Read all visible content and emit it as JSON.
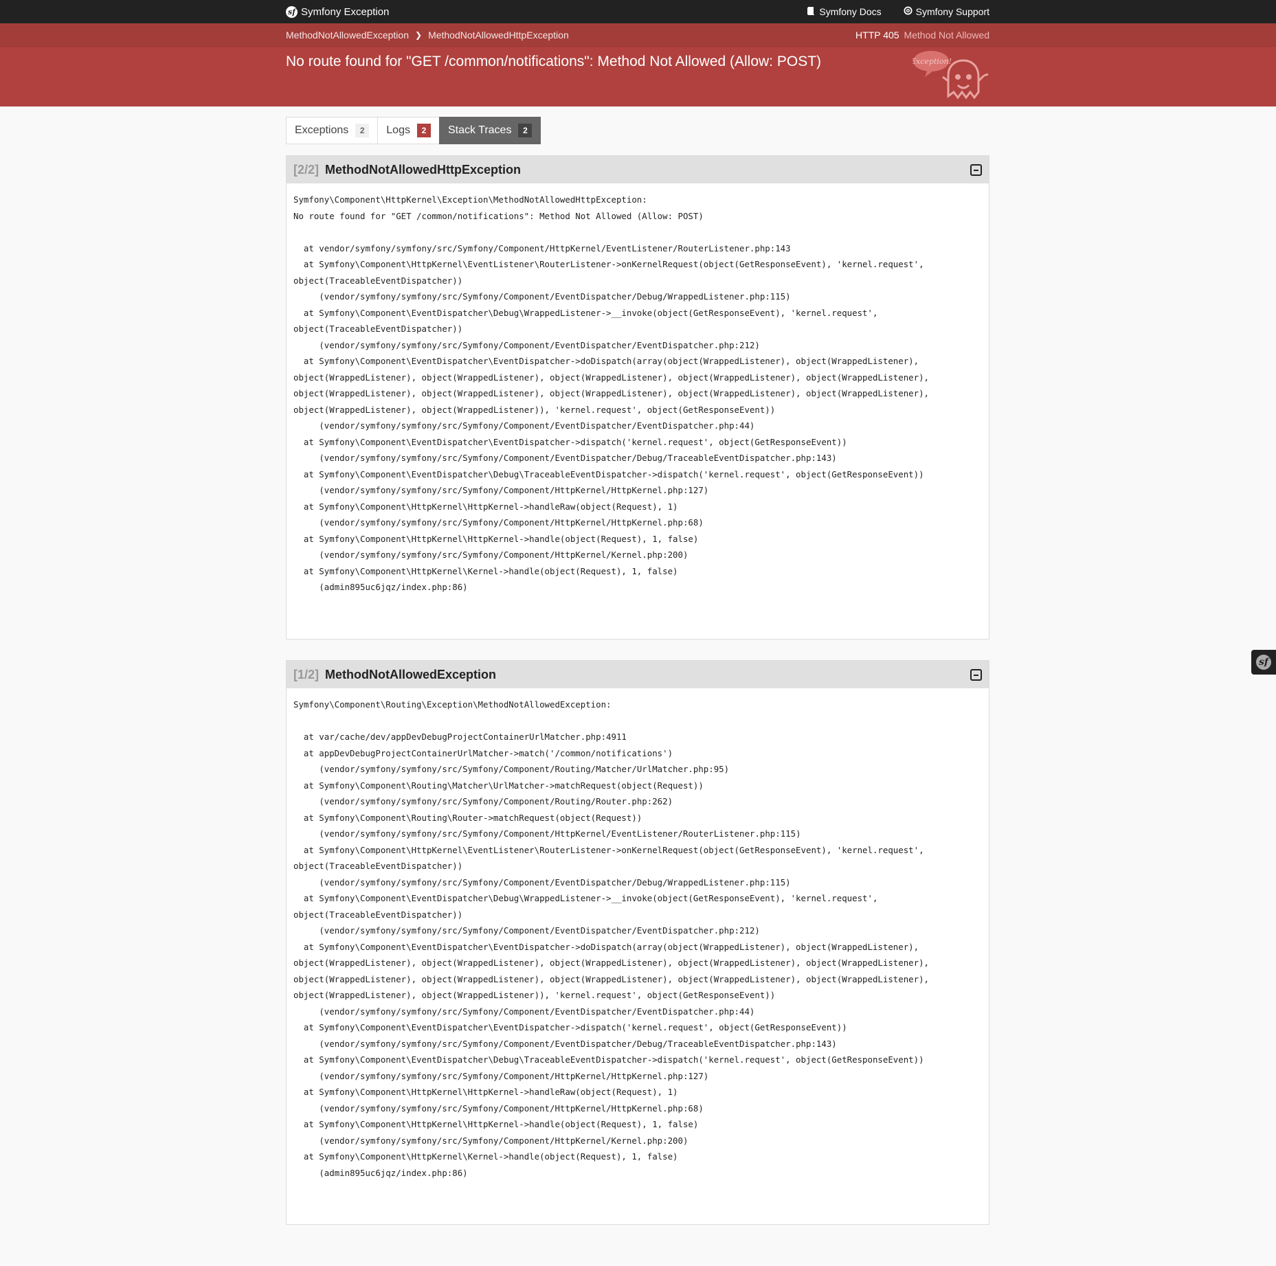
{
  "topbar": {
    "brand": "Symfony Exception",
    "docs_label": "Symfony Docs",
    "support_label": "Symfony Support",
    "logo_glyph": "sf"
  },
  "breadcrumb": {
    "items": [
      "MethodNotAllowedException",
      "MethodNotAllowedHttpException"
    ],
    "separator": "❯"
  },
  "status": {
    "code": "HTTP 405",
    "text": "Method Not Allowed"
  },
  "exception_message": "No route found for \"GET /common/notifications\": Method Not Allowed (Allow: POST)",
  "ghost_bubble_text": "Exception!",
  "tabs": [
    {
      "label": "Exceptions",
      "count": "2"
    },
    {
      "label": "Logs",
      "count": "2"
    },
    {
      "label": "Stack Traces",
      "count": "2"
    }
  ],
  "traces": [
    {
      "index": "[2/2]",
      "title": "MethodNotAllowedHttpException",
      "text": "Symfony\\Component\\HttpKernel\\Exception\\MethodNotAllowedHttpException:\nNo route found for \"GET /common/notifications\": Method Not Allowed (Allow: POST)\n\n  at vendor/symfony/symfony/src/Symfony/Component/HttpKernel/EventListener/RouterListener.php:143\n  at Symfony\\Component\\HttpKernel\\EventListener\\RouterListener->onKernelRequest(object(GetResponseEvent), 'kernel.request',\nobject(TraceableEventDispatcher))\n     (vendor/symfony/symfony/src/Symfony/Component/EventDispatcher/Debug/WrappedListener.php:115)\n  at Symfony\\Component\\EventDispatcher\\Debug\\WrappedListener->__invoke(object(GetResponseEvent), 'kernel.request',\nobject(TraceableEventDispatcher))\n     (vendor/symfony/symfony/src/Symfony/Component/EventDispatcher/EventDispatcher.php:212)\n  at Symfony\\Component\\EventDispatcher\\EventDispatcher->doDispatch(array(object(WrappedListener), object(WrappedListener),\nobject(WrappedListener), object(WrappedListener), object(WrappedListener), object(WrappedListener), object(WrappedListener),\nobject(WrappedListener), object(WrappedListener), object(WrappedListener), object(WrappedListener), object(WrappedListener),\nobject(WrappedListener), object(WrappedListener)), 'kernel.request', object(GetResponseEvent))\n     (vendor/symfony/symfony/src/Symfony/Component/EventDispatcher/EventDispatcher.php:44)\n  at Symfony\\Component\\EventDispatcher\\EventDispatcher->dispatch('kernel.request', object(GetResponseEvent))\n     (vendor/symfony/symfony/src/Symfony/Component/EventDispatcher/Debug/TraceableEventDispatcher.php:143)\n  at Symfony\\Component\\EventDispatcher\\Debug\\TraceableEventDispatcher->dispatch('kernel.request', object(GetResponseEvent))\n     (vendor/symfony/symfony/src/Symfony/Component/HttpKernel/HttpKernel.php:127)\n  at Symfony\\Component\\HttpKernel\\HttpKernel->handleRaw(object(Request), 1)\n     (vendor/symfony/symfony/src/Symfony/Component/HttpKernel/HttpKernel.php:68)\n  at Symfony\\Component\\HttpKernel\\HttpKernel->handle(object(Request), 1, false)\n     (vendor/symfony/symfony/src/Symfony/Component/HttpKernel/Kernel.php:200)\n  at Symfony\\Component\\HttpKernel\\Kernel->handle(object(Request), 1, false)\n     (admin895uc6jqz/index.php:86)"
    },
    {
      "index": "[1/2]",
      "title": "MethodNotAllowedException",
      "text": "Symfony\\Component\\Routing\\Exception\\MethodNotAllowedException:\n\n  at var/cache/dev/appDevDebugProjectContainerUrlMatcher.php:4911\n  at appDevDebugProjectContainerUrlMatcher->match('/common/notifications')\n     (vendor/symfony/symfony/src/Symfony/Component/Routing/Matcher/UrlMatcher.php:95)\n  at Symfony\\Component\\Routing\\Matcher\\UrlMatcher->matchRequest(object(Request))\n     (vendor/symfony/symfony/src/Symfony/Component/Routing/Router.php:262)\n  at Symfony\\Component\\Routing\\Router->matchRequest(object(Request))\n     (vendor/symfony/symfony/src/Symfony/Component/HttpKernel/EventListener/RouterListener.php:115)\n  at Symfony\\Component\\HttpKernel\\EventListener\\RouterListener->onKernelRequest(object(GetResponseEvent), 'kernel.request',\nobject(TraceableEventDispatcher))\n     (vendor/symfony/symfony/src/Symfony/Component/EventDispatcher/Debug/WrappedListener.php:115)\n  at Symfony\\Component\\EventDispatcher\\Debug\\WrappedListener->__invoke(object(GetResponseEvent), 'kernel.request',\nobject(TraceableEventDispatcher))\n     (vendor/symfony/symfony/src/Symfony/Component/EventDispatcher/EventDispatcher.php:212)\n  at Symfony\\Component\\EventDispatcher\\EventDispatcher->doDispatch(array(object(WrappedListener), object(WrappedListener),\nobject(WrappedListener), object(WrappedListener), object(WrappedListener), object(WrappedListener), object(WrappedListener),\nobject(WrappedListener), object(WrappedListener), object(WrappedListener), object(WrappedListener), object(WrappedListener),\nobject(WrappedListener), object(WrappedListener)), 'kernel.request', object(GetResponseEvent))\n     (vendor/symfony/symfony/src/Symfony/Component/EventDispatcher/EventDispatcher.php:44)\n  at Symfony\\Component\\EventDispatcher\\EventDispatcher->dispatch('kernel.request', object(GetResponseEvent))\n     (vendor/symfony/symfony/src/Symfony/Component/EventDispatcher/Debug/TraceableEventDispatcher.php:143)\n  at Symfony\\Component\\EventDispatcher\\Debug\\TraceableEventDispatcher->dispatch('kernel.request', object(GetResponseEvent))\n     (vendor/symfony/symfony/src/Symfony/Component/HttpKernel/HttpKernel.php:127)\n  at Symfony\\Component\\HttpKernel\\HttpKernel->handleRaw(object(Request), 1)\n     (vendor/symfony/symfony/src/Symfony/Component/HttpKernel/HttpKernel.php:68)\n  at Symfony\\Component\\HttpKernel\\HttpKernel->handle(object(Request), 1, false)\n     (vendor/symfony/symfony/src/Symfony/Component/HttpKernel/Kernel.php:200)\n  at Symfony\\Component\\HttpKernel\\Kernel->handle(object(Request), 1, false)\n     (admin895uc6jqz/index.php:86)"
    }
  ],
  "colors": {
    "header_red": "#b0413e",
    "topbar": "#222222",
    "active_tab": "#666666"
  },
  "icons": {
    "docs": "book-icon",
    "support": "lifebuoy-icon",
    "toggle": "collapse-icon"
  }
}
